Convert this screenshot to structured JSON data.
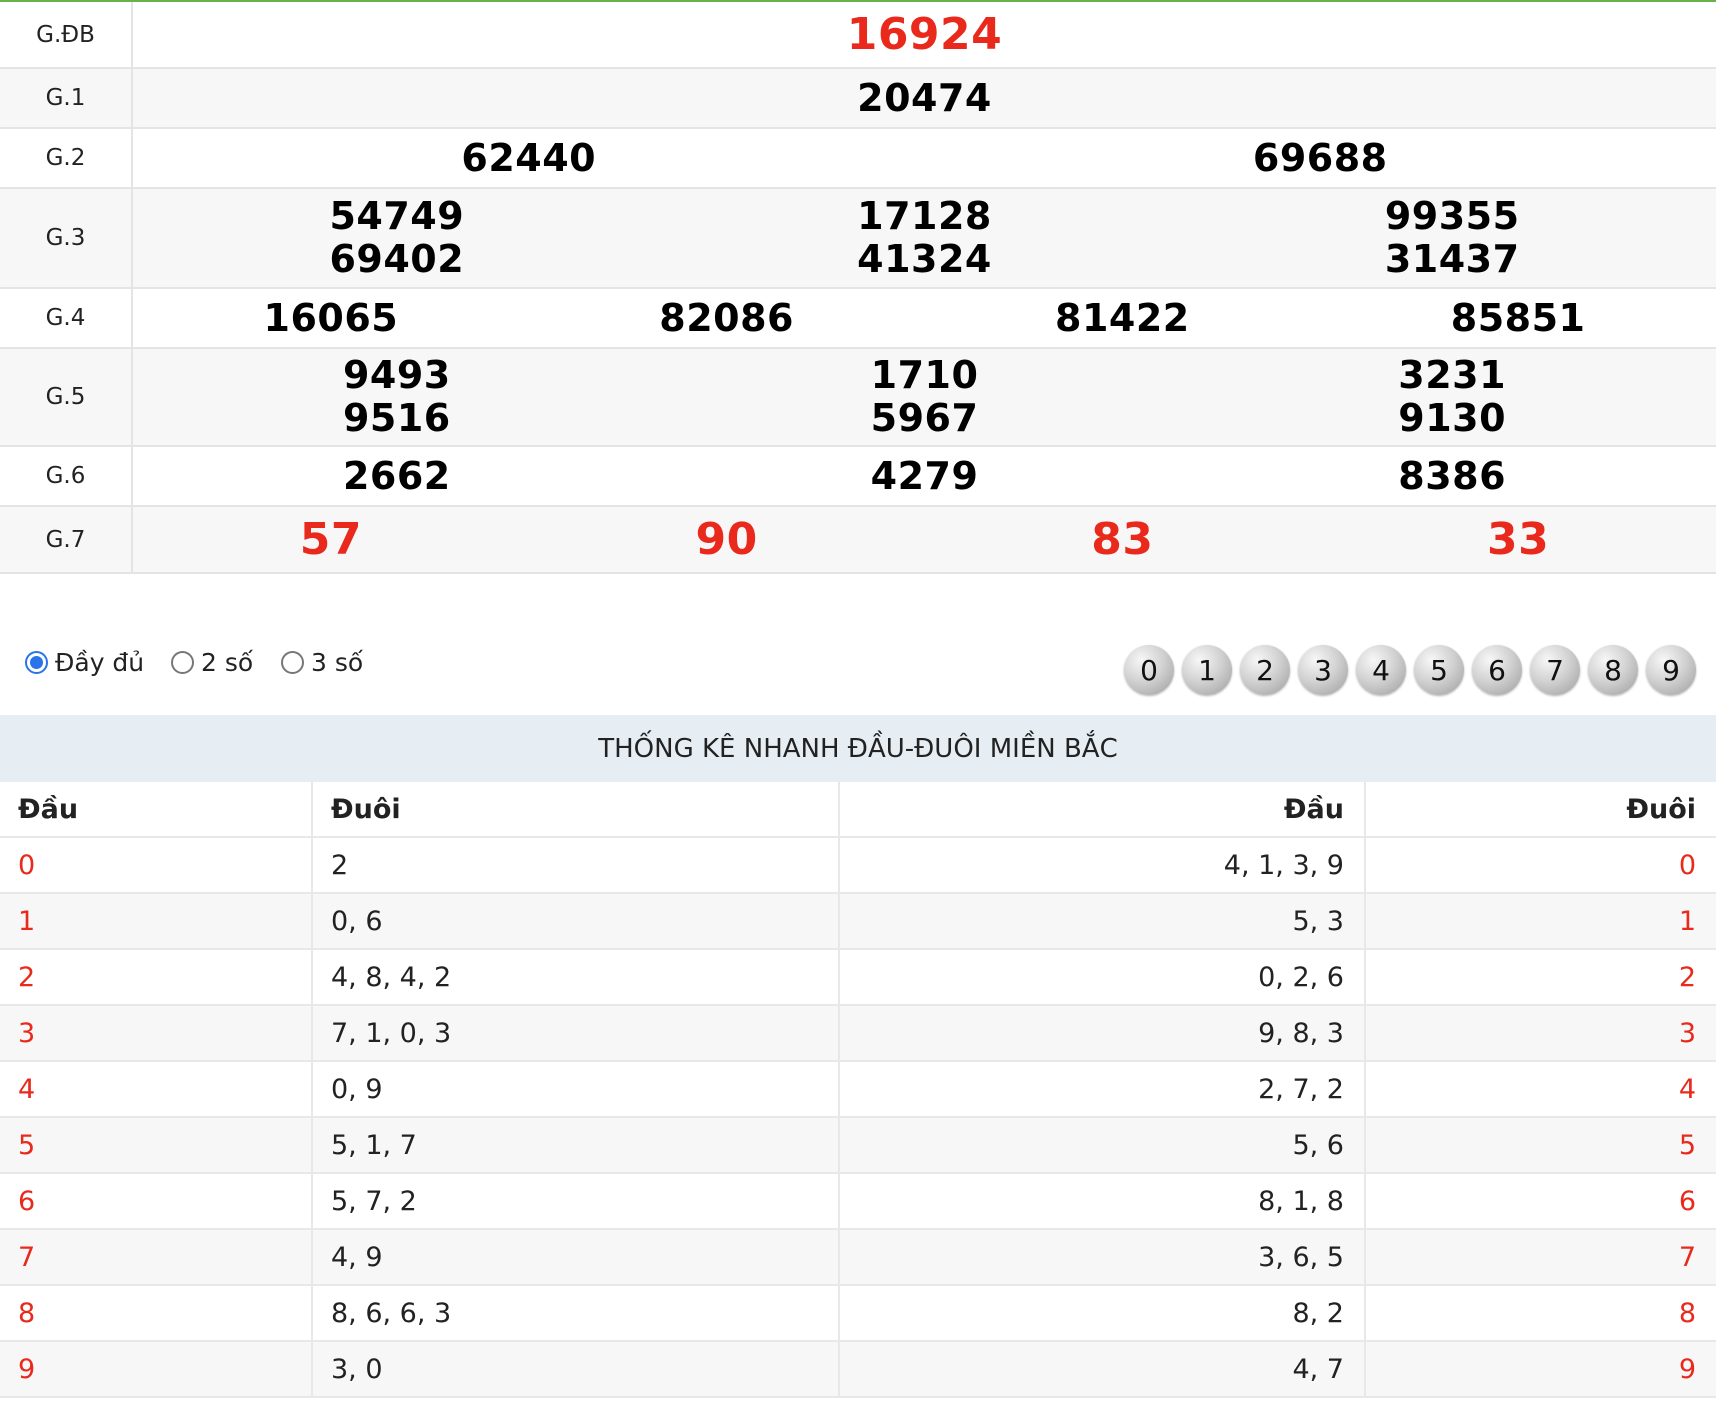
{
  "results": [
    {
      "label": "G.ĐB",
      "cols": [
        [
          "16924"
        ]
      ]
    },
    {
      "label": "G.1",
      "cols": [
        [
          "20474"
        ]
      ]
    },
    {
      "label": "G.2",
      "cols": [
        [
          "62440"
        ],
        [
          "69688"
        ]
      ]
    },
    {
      "label": "G.3",
      "cols": [
        [
          "54749",
          "69402"
        ],
        [
          "17128",
          "41324"
        ],
        [
          "99355",
          "31437"
        ]
      ]
    },
    {
      "label": "G.4",
      "cols": [
        [
          "16065"
        ],
        [
          "82086"
        ],
        [
          "81422"
        ],
        [
          "85851"
        ]
      ]
    },
    {
      "label": "G.5",
      "cols": [
        [
          "9493",
          "9516"
        ],
        [
          "1710",
          "5967"
        ],
        [
          "3231",
          "9130"
        ]
      ]
    },
    {
      "label": "G.6",
      "cols": [
        [
          "2662"
        ],
        [
          "4279"
        ],
        [
          "8386"
        ]
      ]
    },
    {
      "label": "G.7",
      "cols": [
        [
          "57"
        ],
        [
          "90"
        ],
        [
          "83"
        ],
        [
          "33"
        ]
      ]
    }
  ],
  "options": {
    "full": "Đầy đủ",
    "two": "2 số",
    "three": "3 số",
    "selected": "full",
    "digits": [
      "0",
      "1",
      "2",
      "3",
      "4",
      "5",
      "6",
      "7",
      "8",
      "9"
    ]
  },
  "stats": {
    "title": "THỐNG KÊ NHANH ĐẦU-ĐUÔI MIỀN BẮC",
    "headers": [
      "Đầu",
      "Đuôi",
      "Đầu",
      "Đuôi"
    ],
    "rows": [
      [
        "0",
        "2",
        "4, 1, 3, 9",
        "0"
      ],
      [
        "1",
        "0, 6",
        "5, 3",
        "1"
      ],
      [
        "2",
        "4, 8, 4, 2",
        "0, 2, 6",
        "2"
      ],
      [
        "3",
        "7, 1, 0, 3",
        "9, 8, 3",
        "3"
      ],
      [
        "4",
        "0, 9",
        "2, 7, 2",
        "4"
      ],
      [
        "5",
        "5, 1, 7",
        "5, 6",
        "5"
      ],
      [
        "6",
        "5, 7, 2",
        "8, 1, 8",
        "6"
      ],
      [
        "7",
        "4, 9",
        "3, 6, 5",
        "7"
      ],
      [
        "8",
        "8, 6, 6, 3",
        "8, 2",
        "8"
      ],
      [
        "9",
        "3, 0",
        "4, 7",
        "9"
      ]
    ]
  },
  "colors": {
    "accent_red": "#e8291c",
    "radio_blue": "#2b73e8",
    "top_line": "#6ab04c"
  }
}
